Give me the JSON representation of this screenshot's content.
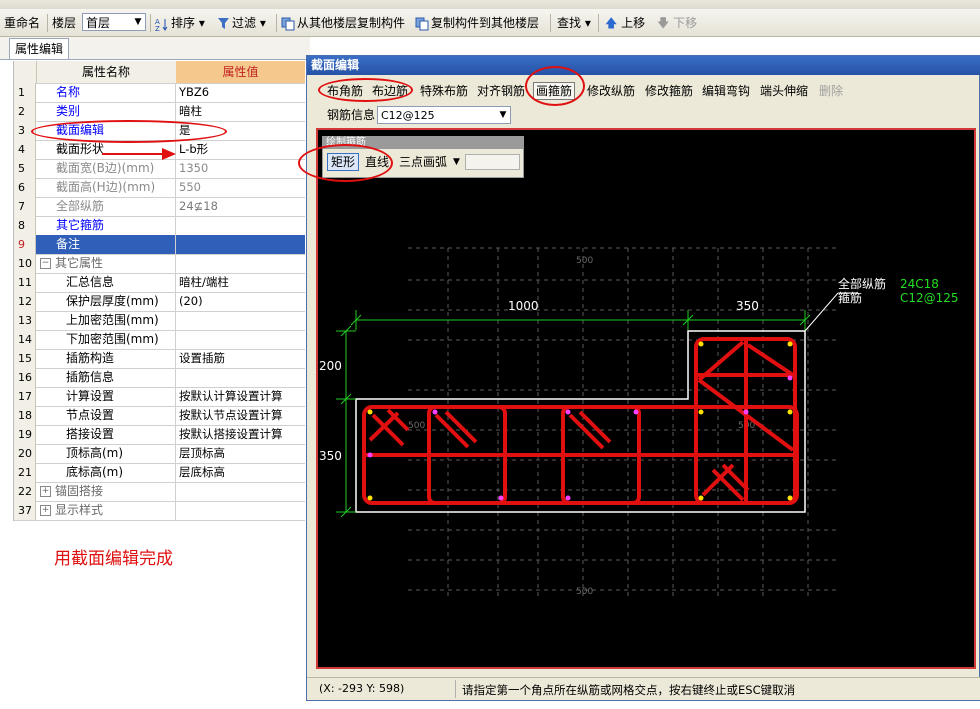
{
  "toolbar": {
    "rename": "重命名",
    "floor_label": "楼层",
    "floor_value": "首层",
    "sort": "排序",
    "filter": "过滤",
    "copy_from_other": "从其他楼层复制构件",
    "copy_to_other": "复制构件到其他楼层",
    "find": "查找",
    "move_up": "上移",
    "move_down": "下移"
  },
  "tab": {
    "label": "属性编辑"
  },
  "table": {
    "col_name": "属性名称",
    "col_value": "属性值",
    "rows": [
      {
        "num": "1",
        "name": "名称",
        "value": "YBZ6"
      },
      {
        "num": "2",
        "name": "类别",
        "value": "暗柱"
      },
      {
        "num": "3",
        "name": "截面编辑",
        "value": "是"
      },
      {
        "num": "4",
        "name": "截面形状",
        "value": "L-b形"
      },
      {
        "num": "5",
        "name": "截面宽(B边)(mm)",
        "value": "1350"
      },
      {
        "num": "6",
        "name": "截面高(H边)(mm)",
        "value": "550"
      },
      {
        "num": "7",
        "name": "全部纵筋",
        "value": "24⊈18"
      },
      {
        "num": "8",
        "name": "其它箍筋",
        "value": ""
      },
      {
        "num": "9",
        "name": "备注",
        "value": ""
      },
      {
        "num": "10",
        "name": "其它属性",
        "value": ""
      },
      {
        "num": "11",
        "name": "汇总信息",
        "value": "暗柱/端柱"
      },
      {
        "num": "12",
        "name": "保护层厚度(mm)",
        "value": "(20)"
      },
      {
        "num": "13",
        "name": "上加密范围(mm)",
        "value": ""
      },
      {
        "num": "14",
        "name": "下加密范围(mm)",
        "value": ""
      },
      {
        "num": "15",
        "name": "插筋构造",
        "value": "设置插筋"
      },
      {
        "num": "16",
        "name": "插筋信息",
        "value": ""
      },
      {
        "num": "17",
        "name": "计算设置",
        "value": "按默认计算设置计算"
      },
      {
        "num": "18",
        "name": "节点设置",
        "value": "按默认节点设置计算"
      },
      {
        "num": "19",
        "name": "搭接设置",
        "value": "按默认搭接设置计算"
      },
      {
        "num": "20",
        "name": "顶标高(m)",
        "value": "层顶标高"
      },
      {
        "num": "21",
        "name": "底标高(m)",
        "value": "层底标高"
      },
      {
        "num": "22",
        "name": "锚固搭接",
        "value": ""
      },
      {
        "num": "37",
        "name": "显示样式",
        "value": ""
      }
    ]
  },
  "note": "用截面编辑完成",
  "dialog": {
    "title": "截面编辑",
    "buttons": [
      "布角筋",
      "布边筋",
      "特殊布筋",
      "对齐钢筋",
      "画箍筋",
      "修改纵筋",
      "修改箍筋",
      "编辑弯钩",
      "端头伸缩",
      "删除"
    ],
    "rebar_info_label": "钢筋信息",
    "rebar_info_value": "C12@125",
    "draw_panel_title": "绘制箍筋",
    "draw_rect": "矩形",
    "draw_line": "直线",
    "draw_arc": "三点画弧"
  },
  "drawing": {
    "dim_top_left": "1000",
    "dim_top_right": "350",
    "dim_left_upper": "200",
    "dim_left_lower": "350",
    "grid_label": "500",
    "leader_label_1": "全部纵筋",
    "leader_value_1": "24C18",
    "leader_label_2": "箍筋",
    "leader_value_2": "C12@125"
  },
  "status": {
    "coords": "(X: -293 Y: 598)",
    "message": "请指定第一个角点所在纵筋或网格交点，按右键终止或ESC键取消"
  },
  "colors": {
    "rebar": "#e01010",
    "dimension": "#22cc22",
    "title_bar": "#2552a6",
    "highlight_row": "#2f5fb8",
    "value_header": "#f5c98e"
  }
}
